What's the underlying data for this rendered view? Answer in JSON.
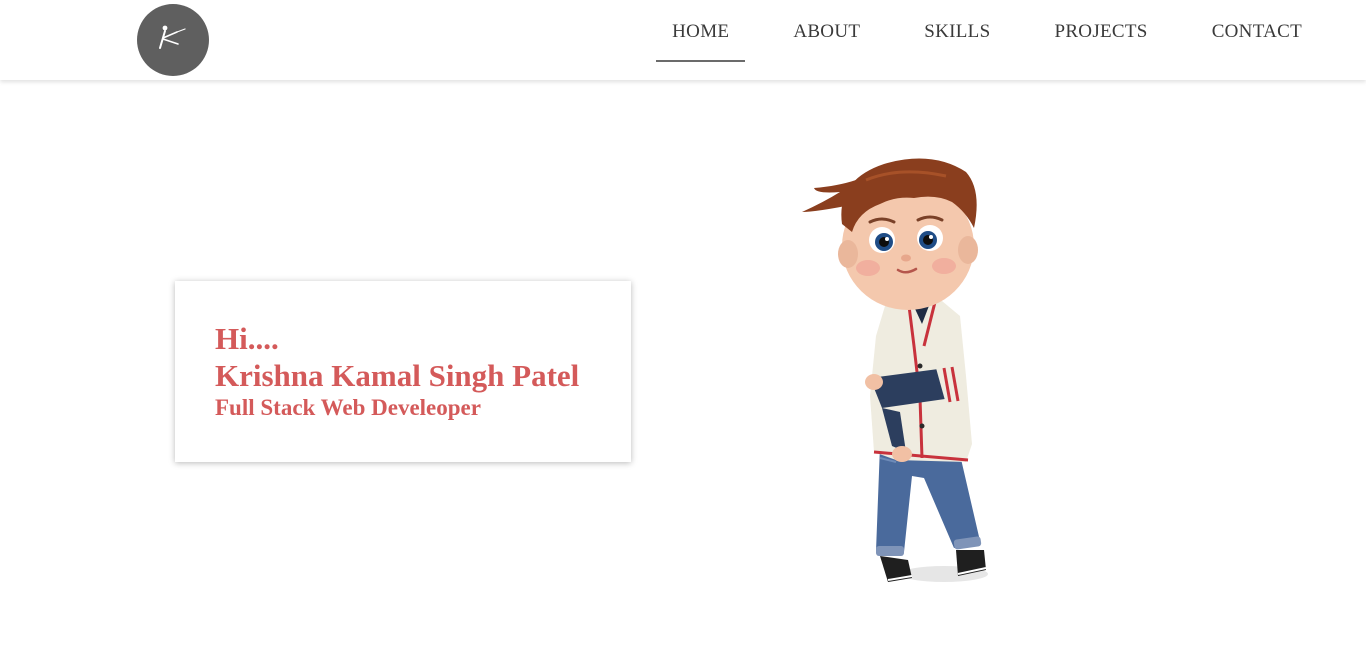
{
  "nav": {
    "logo_icon": "stick-figure-logo-icon",
    "items": [
      {
        "label": "HOME",
        "active": true
      },
      {
        "label": "ABOUT",
        "active": false
      },
      {
        "label": "SKILLS",
        "active": false
      },
      {
        "label": "PROJECTS",
        "active": false
      },
      {
        "label": "CONTACT",
        "active": false
      }
    ]
  },
  "intro": {
    "greeting": "Hi....",
    "name": "Krishna Kamal Singh Patel",
    "role": "Full Stack Web Develeoper"
  },
  "colors": {
    "accent": "#d45a5a",
    "logo_bg": "#5f5f5f",
    "nav_text": "#3a3a3a",
    "active_underline": "#6b6b6b"
  },
  "hero": {
    "illustration": "cartoon-boy-illustration"
  }
}
